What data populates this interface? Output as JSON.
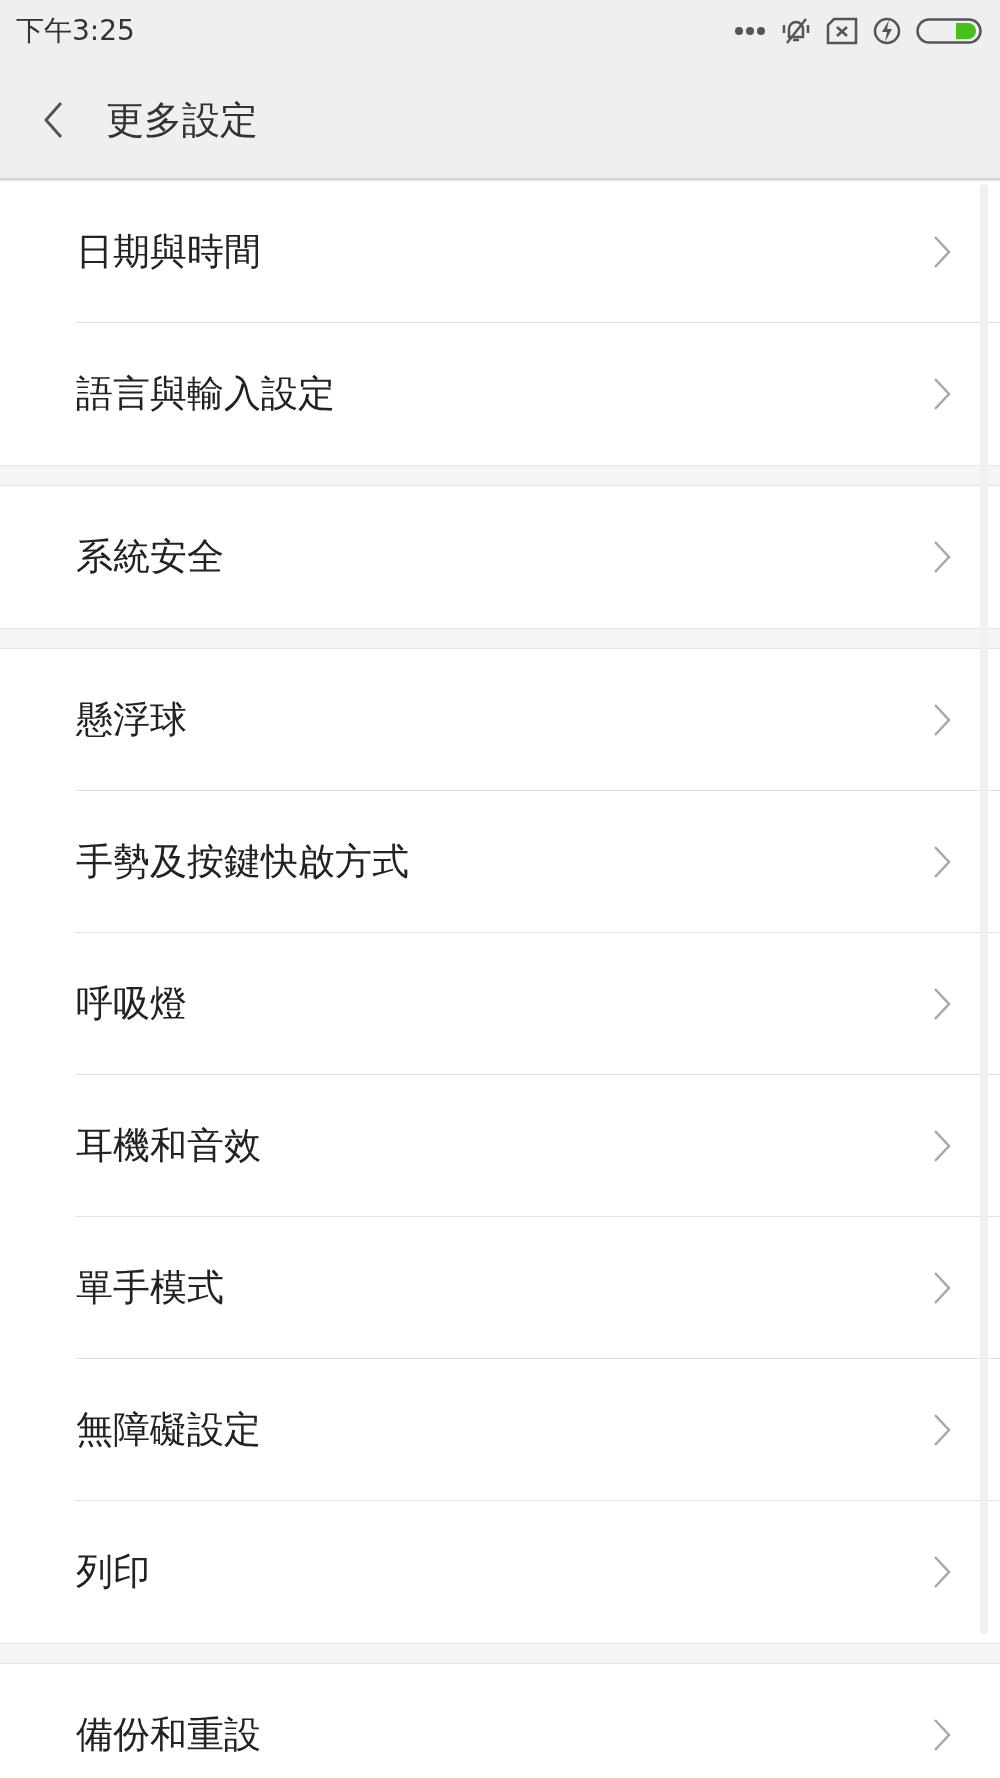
{
  "status_bar": {
    "time": "下午3:25"
  },
  "header": {
    "title": "更多設定"
  },
  "groups": [
    {
      "items": [
        "日期與時間",
        "語言與輸入設定"
      ]
    },
    {
      "items": [
        "系統安全"
      ]
    },
    {
      "items": [
        "懸浮球",
        "手勢及按鍵快啟方式",
        "呼吸燈",
        "耳機和音效",
        "單手模式",
        "無障礙設定",
        "列印"
      ]
    },
    {
      "items": [
        "備份和重設"
      ]
    }
  ]
}
